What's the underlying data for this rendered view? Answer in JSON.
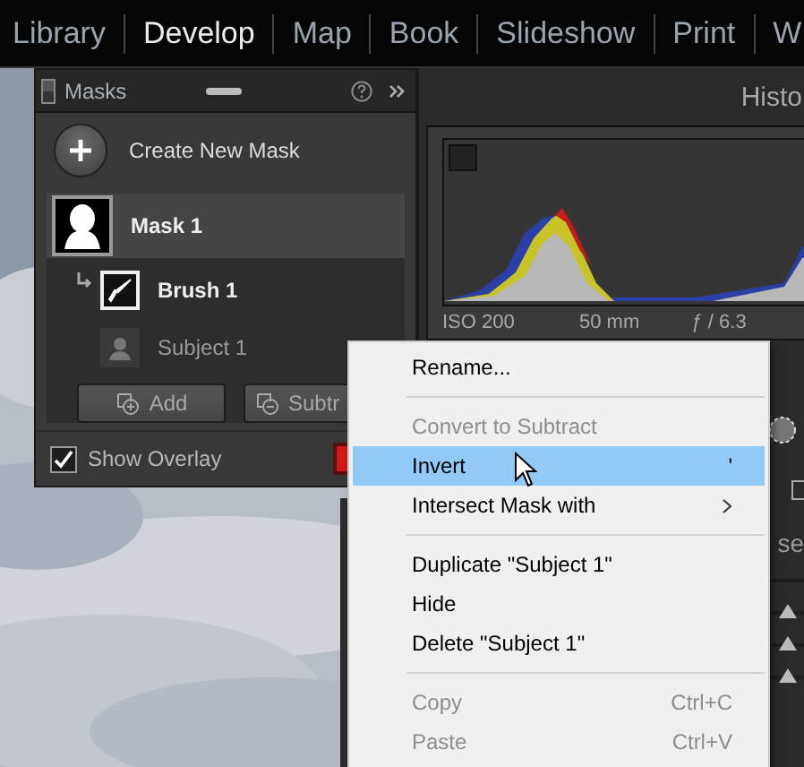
{
  "module_tabs": [
    {
      "label": "Library",
      "selected": false
    },
    {
      "label": "Develop",
      "selected": true
    },
    {
      "label": "Map",
      "selected": false
    },
    {
      "label": "Book",
      "selected": false
    },
    {
      "label": "Slideshow",
      "selected": false
    },
    {
      "label": "Print",
      "selected": false
    },
    {
      "label": "W",
      "selected": false
    }
  ],
  "right_panel": {
    "title": "Histo",
    "histogram_info": [
      "ISO 200",
      "50 mm",
      "ƒ / 6.3"
    ],
    "section_label": "se"
  },
  "masks_panel": {
    "title": "Masks",
    "create_label": "Create New Mask",
    "masks": [
      {
        "kind": "mask",
        "name": "Mask 1",
        "selected": true,
        "children": [
          {
            "kind": "brush",
            "name": "Brush 1",
            "selected": false
          },
          {
            "kind": "subject",
            "name": "Subject 1",
            "selected": false
          }
        ]
      }
    ],
    "buttons": [
      {
        "kind": "add",
        "label": "Add"
      },
      {
        "kind": "subtract",
        "label": "Subtr"
      }
    ],
    "show_overlay": {
      "label": "Show Overlay",
      "checked": true,
      "color": "#d01a1a"
    }
  },
  "context_menu": {
    "groups": [
      [
        {
          "label": "Rename...",
          "disabled": false,
          "selected": false,
          "submenu": false
        }
      ],
      [
        {
          "label": "Convert to Subtract",
          "disabled": true,
          "selected": false,
          "submenu": false
        },
        {
          "label": "Invert",
          "shortcut": "'",
          "disabled": false,
          "selected": true,
          "submenu": false
        },
        {
          "label": "Intersect Mask with",
          "disabled": false,
          "selected": false,
          "submenu": true
        }
      ],
      [
        {
          "label": "Duplicate \"Subject 1\"",
          "disabled": false,
          "selected": false,
          "submenu": false
        },
        {
          "label": "Hide",
          "disabled": false,
          "selected": false,
          "submenu": false
        },
        {
          "label": "Delete \"Subject 1\"",
          "disabled": false,
          "selected": false,
          "submenu": false
        }
      ],
      [
        {
          "label": "Copy",
          "shortcut": "Ctrl+C",
          "disabled": true,
          "selected": false,
          "submenu": false
        },
        {
          "label": "Paste",
          "shortcut": "Ctrl+V",
          "disabled": true,
          "selected": false,
          "submenu": false
        }
      ]
    ]
  }
}
